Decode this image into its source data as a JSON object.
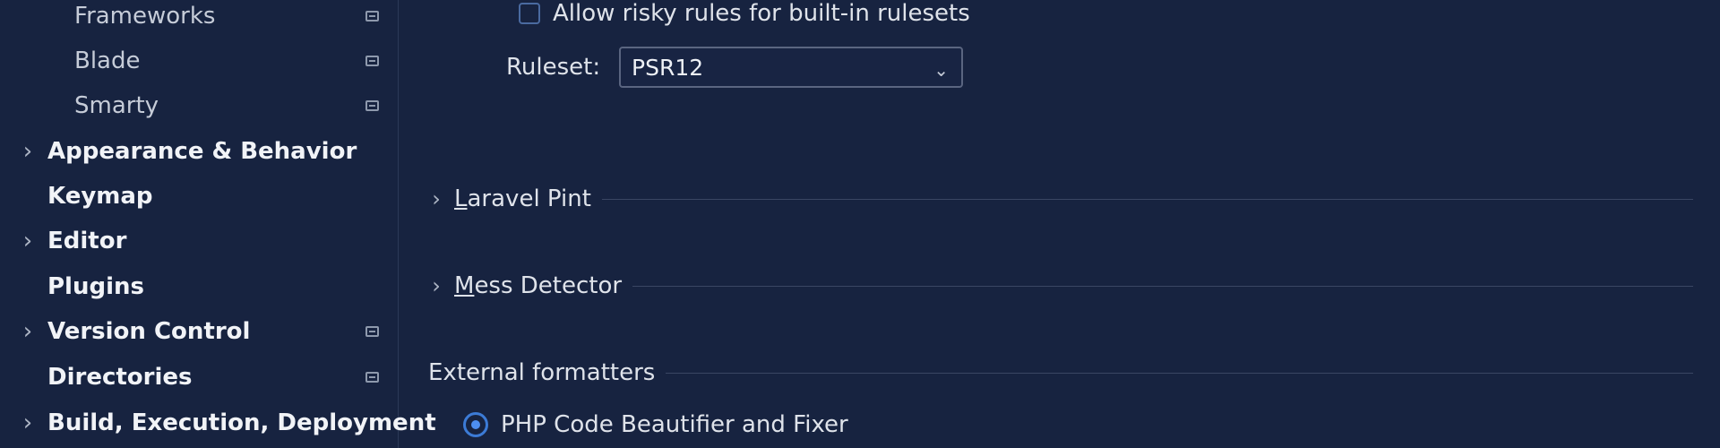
{
  "sidebar": {
    "items": [
      {
        "label": "Frameworks",
        "level": "child",
        "chevron": false,
        "project_icon": true
      },
      {
        "label": "Blade",
        "level": "child",
        "chevron": false,
        "project_icon": true
      },
      {
        "label": "Smarty",
        "level": "child",
        "chevron": false,
        "project_icon": true
      },
      {
        "label": "Appearance & Behavior",
        "level": "top",
        "chevron": true,
        "project_icon": false
      },
      {
        "label": "Keymap",
        "level": "top",
        "chevron": false,
        "project_icon": false
      },
      {
        "label": "Editor",
        "level": "top",
        "chevron": true,
        "project_icon": false
      },
      {
        "label": "Plugins",
        "level": "top",
        "chevron": false,
        "project_icon": false
      },
      {
        "label": "Version Control",
        "level": "top",
        "chevron": true,
        "project_icon": true
      },
      {
        "label": "Directories",
        "level": "top",
        "chevron": false,
        "project_icon": true
      },
      {
        "label": "Build, Execution, Deployment",
        "level": "top",
        "chevron": true,
        "project_icon": false
      }
    ]
  },
  "main": {
    "risky_rules": {
      "label": "Allow risky rules for built-in rulesets",
      "checked": false
    },
    "ruleset": {
      "label": "Ruleset:",
      "value": "PSR12"
    },
    "sections": {
      "laravel_pint": {
        "mnemonic": "L",
        "rest": "aravel Pint"
      },
      "mess_detector": {
        "mnemonic": "M",
        "rest": "ess Detector"
      },
      "external_formatters": {
        "title": "External formatters"
      }
    },
    "formatter_option": {
      "label": "PHP Code Beautifier and Fixer",
      "selected": true
    }
  },
  "icons": {
    "chevron_right": "›",
    "chevron_down": "⌄"
  },
  "colors": {
    "background": "#172340",
    "accent": "#3c7bd6"
  }
}
